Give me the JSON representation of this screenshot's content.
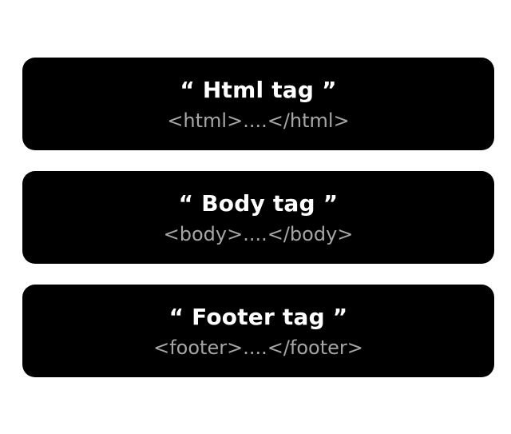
{
  "cards": [
    {
      "title": "“ Html tag ”",
      "code": "<html>....</html>"
    },
    {
      "title": "“ Body tag ”",
      "code": "<body>....</body>"
    },
    {
      "title": "“ Footer tag ”",
      "code": "<footer>....</footer>"
    }
  ],
  "colors": {
    "background": "#ffffff",
    "card": "#000000",
    "title": "#ffffff",
    "code": "#a6a6a6"
  }
}
